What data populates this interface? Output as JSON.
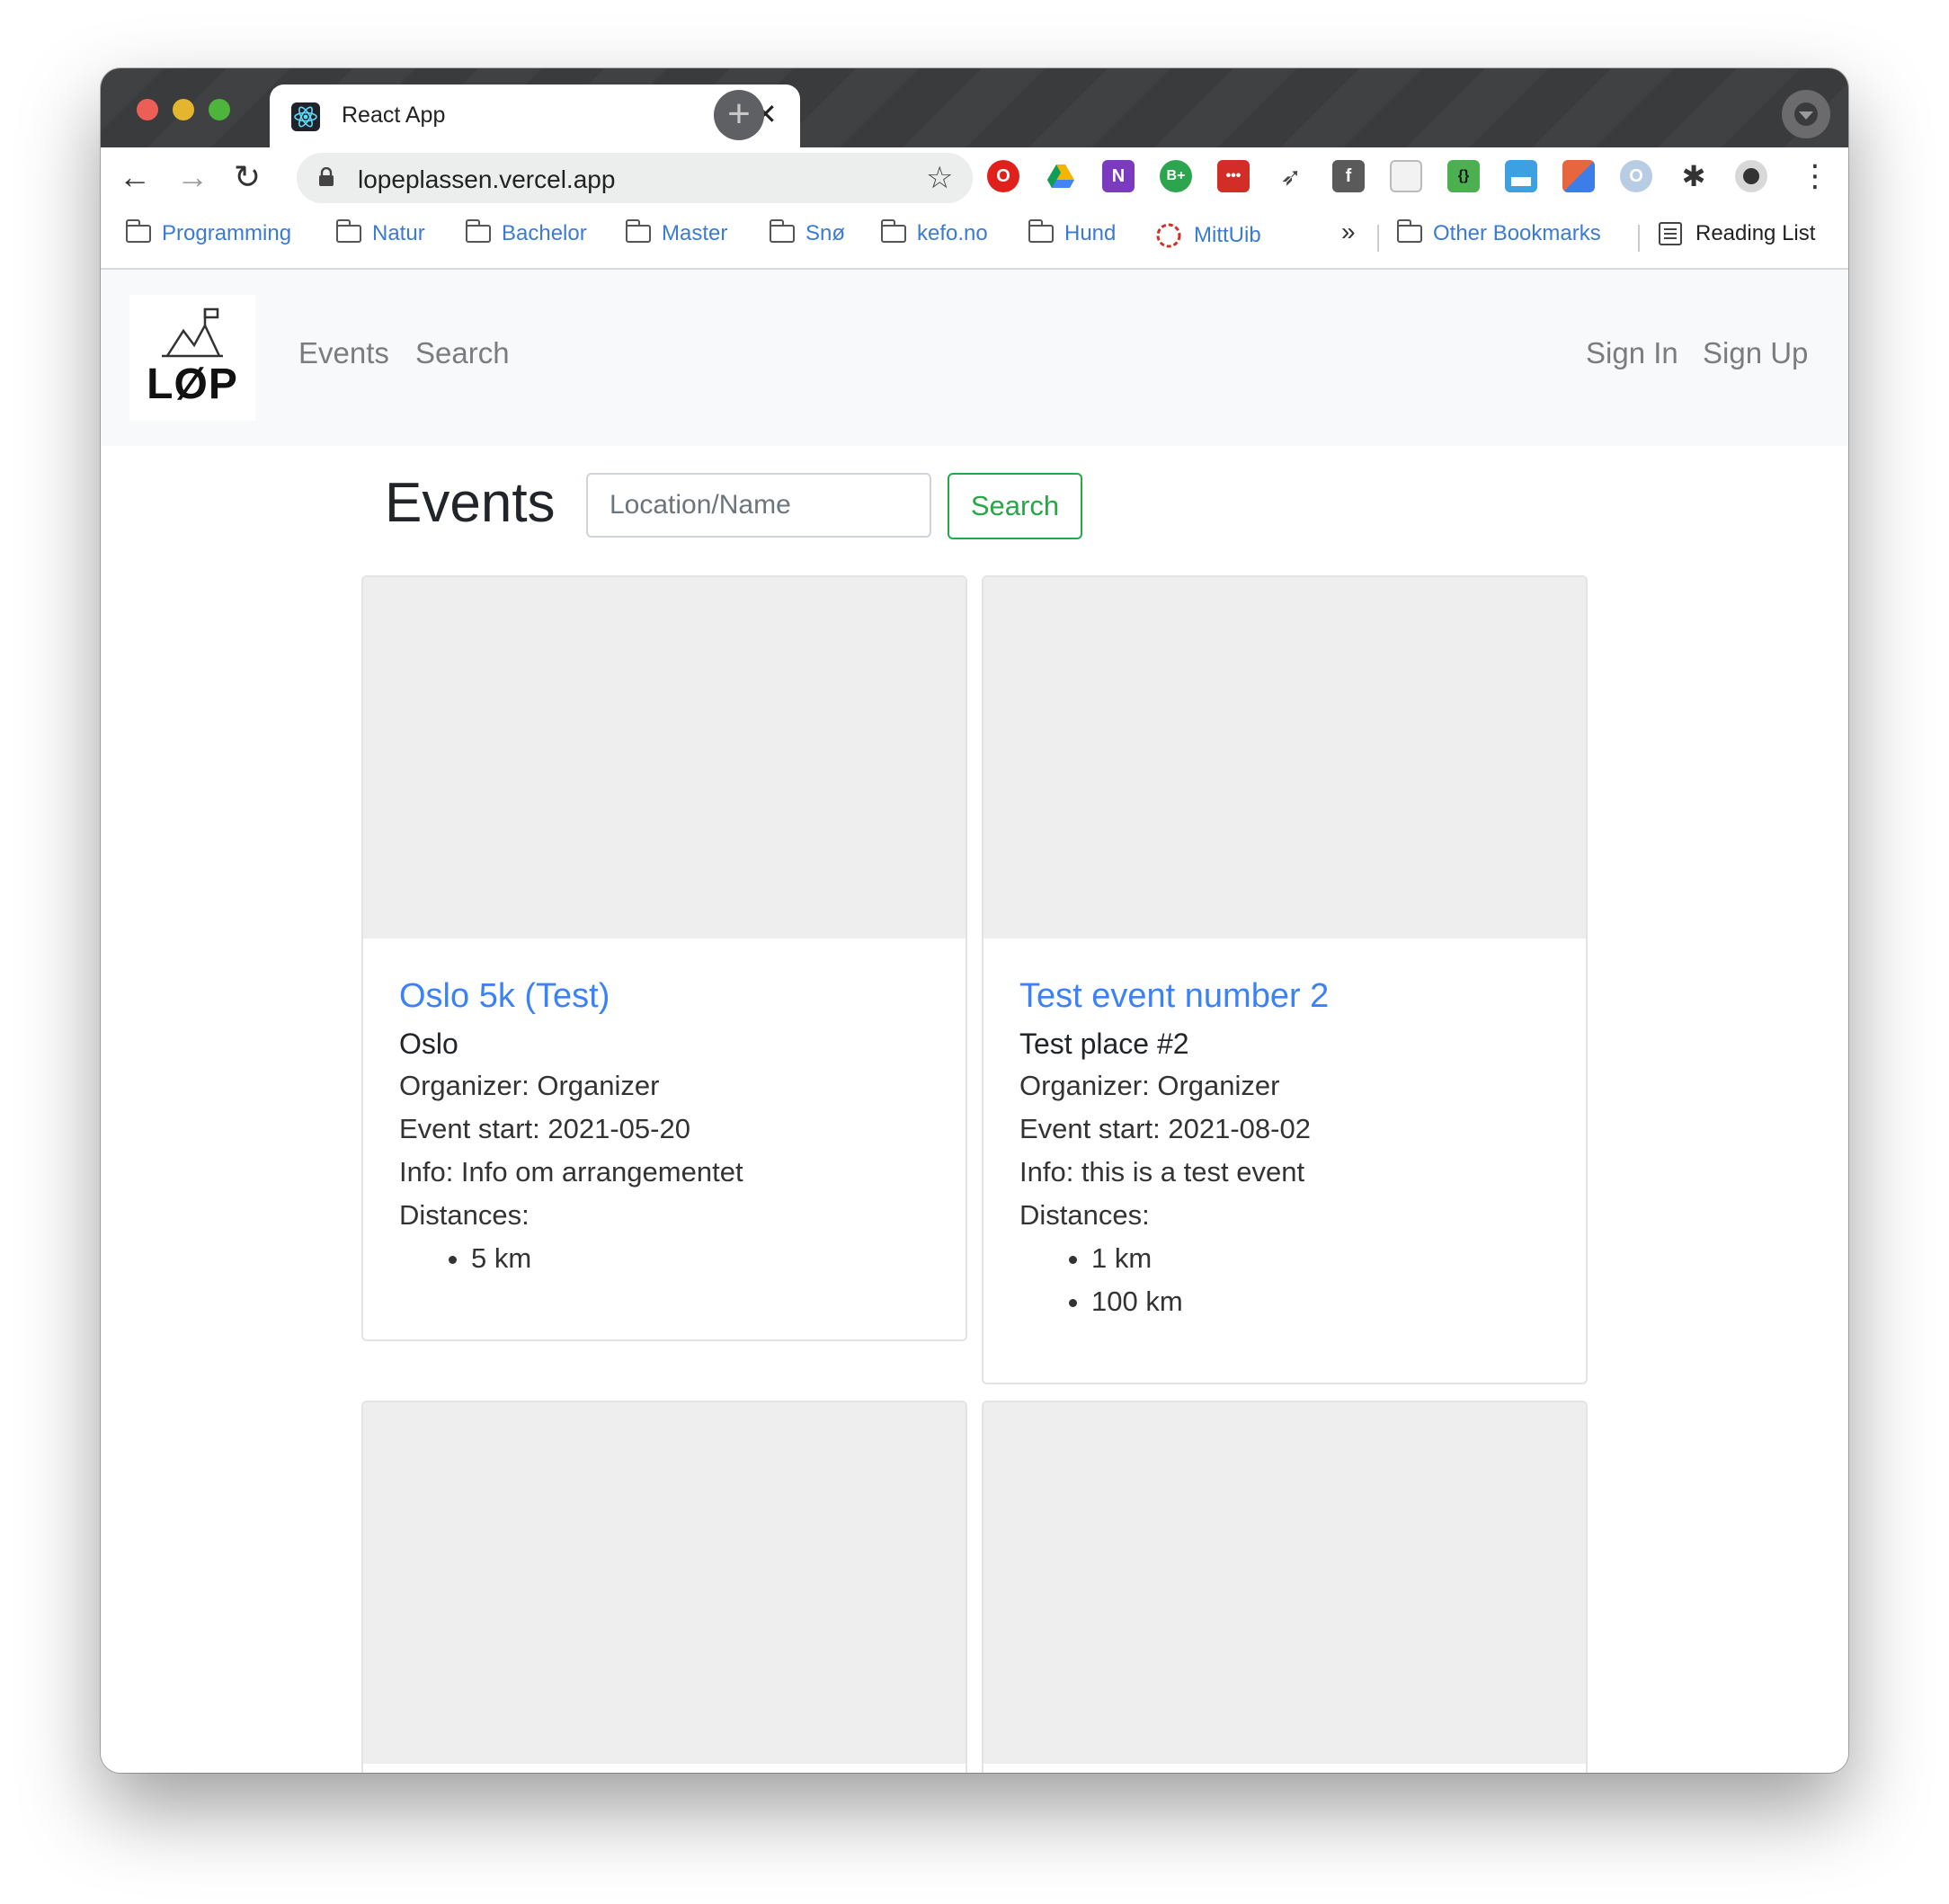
{
  "browser": {
    "tab_title": "React App",
    "tab_close": "✕",
    "new_tab": "+",
    "url": "lopeplassen.vercel.app",
    "back": "←",
    "forward": "→",
    "reload": "↻",
    "star": "☆",
    "menu": "⋮",
    "extensions": [
      {
        "icon": "opera-icon",
        "color": "#e0211b",
        "glyph": "O"
      },
      {
        "icon": "drive-icon",
        "color": "#f4b400",
        "glyph": "▲"
      },
      {
        "icon": "onenote-icon",
        "color": "#7b3bbf",
        "glyph": "N"
      },
      {
        "icon": "bplus-icon",
        "color": "#2da44e",
        "glyph": "B+"
      },
      {
        "icon": "lastpass-icon",
        "color": "#d32d27",
        "glyph": "•••"
      },
      {
        "icon": "rocket-icon",
        "color": "#444444",
        "glyph": "🚀"
      },
      {
        "icon": "facebook-icon",
        "color": "#555555",
        "glyph": "f"
      },
      {
        "icon": "page-icon",
        "color": "#bbbbbb",
        "glyph": "▭"
      },
      {
        "icon": "json-icon",
        "color": "#4caf50",
        "glyph": "{}"
      },
      {
        "icon": "window-icon",
        "color": "#3da0e0",
        "glyph": "▦"
      },
      {
        "icon": "palette-icon",
        "color": "#e8663d",
        "glyph": "■"
      },
      {
        "icon": "o-icon",
        "color": "#8aa4c8",
        "glyph": "O"
      },
      {
        "icon": "puzzle-icon",
        "color": "#333333",
        "glyph": "✱"
      },
      {
        "icon": "avatar-icon",
        "color": "#444444",
        "glyph": "●"
      }
    ]
  },
  "bookmarks": {
    "items": [
      {
        "label": "Programming",
        "icon": "folder-icon"
      },
      {
        "label": "Natur",
        "icon": "folder-icon"
      },
      {
        "label": "Bachelor",
        "icon": "folder-icon"
      },
      {
        "label": "Master",
        "icon": "folder-icon"
      },
      {
        "label": "Snø",
        "icon": "folder-icon"
      },
      {
        "label": "kefo.no",
        "icon": "folder-icon"
      },
      {
        "label": "Hund",
        "icon": "folder-icon"
      },
      {
        "label": "MittUib",
        "icon": "mittuib-icon"
      }
    ],
    "overflow": "»",
    "other": "Other Bookmarks",
    "reading_list": "Reading List"
  },
  "navbar": {
    "logo_text": "LØP",
    "links": [
      "Events",
      "Search"
    ],
    "auth": [
      "Sign In",
      "Sign Up"
    ]
  },
  "main": {
    "heading": "Events",
    "search_placeholder": "Location/Name",
    "search_button": "Search"
  },
  "events": [
    {
      "title": "Oslo 5k (Test)",
      "location": "Oslo",
      "organizer": "Organizer: Organizer",
      "start": "Event start: 2021-05-20",
      "info": "Info: Info om arrangementet",
      "distances_label": "Distances:",
      "distances": [
        "5 km"
      ]
    },
    {
      "title": "Test event number 2",
      "location": "Test place #2",
      "organizer": "Organizer: Organizer",
      "start": "Event start: 2021-08-02",
      "info": "Info: this is a test event",
      "distances_label": "Distances:",
      "distances": [
        "1 km",
        "100 km"
      ]
    }
  ]
}
